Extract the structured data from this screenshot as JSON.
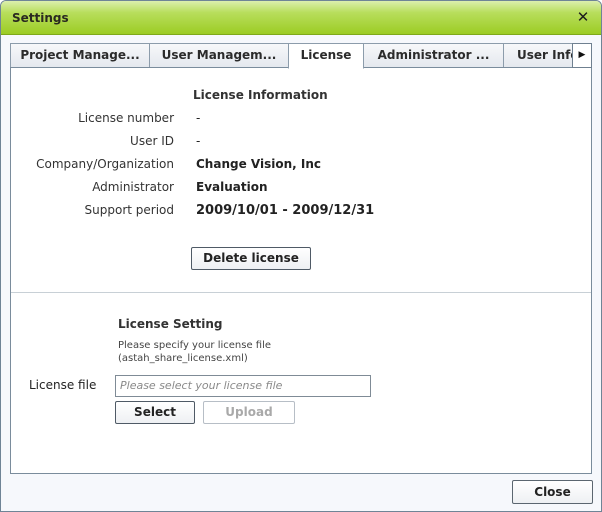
{
  "window": {
    "title": "Settings",
    "close_icon": "close-x-icon",
    "accent_color": "#9ccc24"
  },
  "tabs": [
    {
      "label": "Project Manage...",
      "active": false
    },
    {
      "label": "User Managem...",
      "active": false
    },
    {
      "label": "License",
      "active": true
    },
    {
      "label": "Administrator ...",
      "active": false
    },
    {
      "label": "User Info",
      "active": false
    }
  ],
  "tab_scroll_icon": "triangle-right-icon",
  "license_info": {
    "title": "License Information",
    "rows": [
      {
        "label": "License number",
        "value": "-"
      },
      {
        "label": "User ID",
        "value": "-"
      },
      {
        "label": "Company/Organization",
        "value": "Change Vision, Inc"
      },
      {
        "label": "Administrator",
        "value": "Evaluation"
      },
      {
        "label": "Support period",
        "value": "2009/10/01 - 2009/12/31"
      }
    ],
    "delete_button": "Delete license"
  },
  "license_setting": {
    "title": "License Setting",
    "hint_line1": "Please specify your license file",
    "hint_line2": "(astah_share_license.xml)",
    "file_label": "License file",
    "file_placeholder": "Please select your license file",
    "file_value": "",
    "select_button": "Select",
    "upload_button": "Upload"
  },
  "footer": {
    "close_button": "Close"
  }
}
